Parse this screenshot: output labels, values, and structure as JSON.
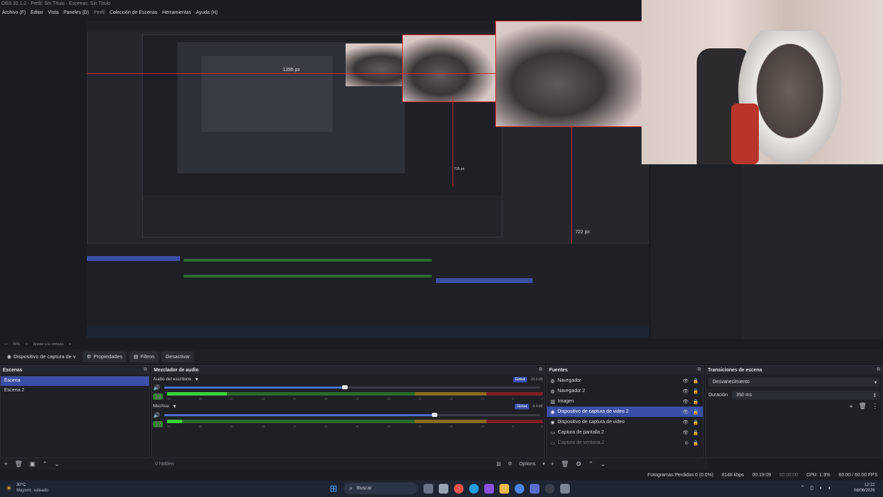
{
  "window": {
    "title": "OBS 32.1.2 - Perfil: Sin Título - Escenas: Sin Título"
  },
  "menu": {
    "items": [
      "Archivo (F)",
      "Editar",
      "Vista",
      "Paneles (D)",
      "Perfil",
      "Colección de Escenas",
      "Herramientas",
      "Ayuda (H)"
    ]
  },
  "preview": {
    "label_width": "1395 px",
    "label_height_a": "716 px",
    "label_height_b": "722 px"
  },
  "zoom": {
    "value": "80%",
    "fit": "Ajustar a la ventana"
  },
  "source_bar": {
    "selected_source": "Dispositivo de captura de v",
    "properties": "Propiedades",
    "filters": "Filtros",
    "deactivate": "Desactivar"
  },
  "scenes": {
    "title": "Escenas",
    "items": [
      "Escena",
      "Escena 2"
    ]
  },
  "mixer": {
    "title": "Mezclador de audio",
    "channels": [
      {
        "name": "Audio del escritorio",
        "badge": "Global",
        "db": "-20.6 dB",
        "level": 0.16,
        "volume": 0.48
      },
      {
        "name": "Mic/Aux",
        "badge": "Global",
        "db": "-8.4 dB",
        "level": 0.04,
        "volume": 0.72
      }
    ],
    "ticks": [
      "-60",
      "-55",
      "-50",
      "-45",
      "-40",
      "-35",
      "-30",
      "-25",
      "-20",
      "-15",
      "-10",
      "-5",
      "0"
    ],
    "hidden": "0 hidden",
    "options": "Options"
  },
  "sources": {
    "title": "Fuentes",
    "items": [
      {
        "name": "Navegador",
        "icon": "globe-icon"
      },
      {
        "name": "Navegador 2",
        "icon": "globe-icon"
      },
      {
        "name": "Imagen",
        "icon": "image-icon"
      },
      {
        "name": "Dispositivo de captura de video 2",
        "icon": "camera-icon"
      },
      {
        "name": "Dispositivo de captura de video",
        "icon": "camera-icon"
      },
      {
        "name": "Captura de pantalla 2",
        "icon": "monitor-icon"
      },
      {
        "name": "Captura de ventana 2",
        "icon": "window-icon"
      }
    ]
  },
  "transitions": {
    "title": "Transiciones de escena",
    "transition": "Desvanecimiento",
    "duration_label": "Duración",
    "duration": "350 ms"
  },
  "status": {
    "dropped": "Fotogramas Perdidos 0 (0.0%)",
    "kbps": "8148 kbps",
    "rec_time": "00:19:09",
    "stream_time": "00:00:00",
    "cpu": "CPU: 1.9%",
    "fps": "60.00 / 60.00 FPS"
  },
  "taskbar": {
    "weather_temp": "30°C",
    "weather_desc": "Mayorm. soleado",
    "search": "Buscar",
    "time": "12:22",
    "date": "08/06/2026",
    "colors": {
      "bg": "#1d2533",
      "accent": "#3a4fa5",
      "rec": "#d6242a"
    }
  }
}
